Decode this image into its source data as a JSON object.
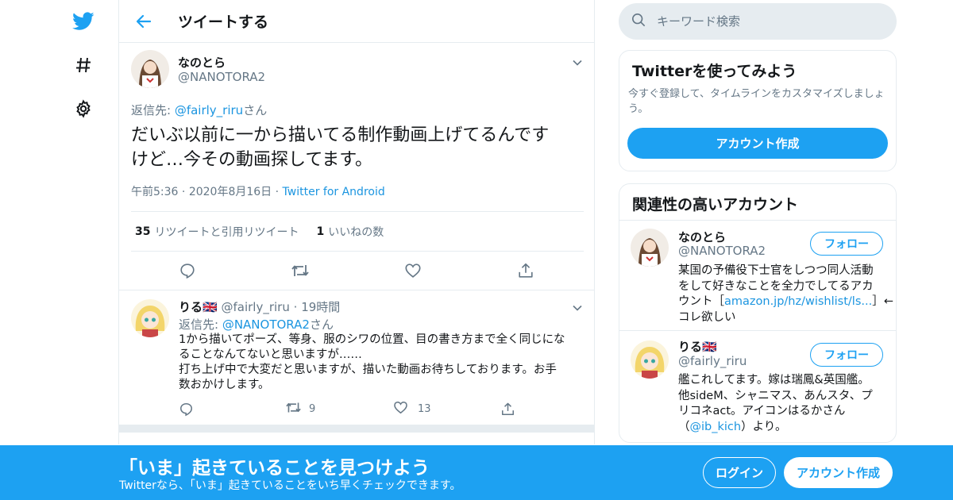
{
  "nav": {
    "icons": [
      "twitter-bird-icon",
      "hashtag-icon",
      "gear-icon"
    ]
  },
  "header": {
    "title": "ツイートする"
  },
  "main_tweet": {
    "name": "なのとら",
    "handle": "@NANOTORA2",
    "reply_prefix": "返信先: ",
    "reply_to": "@fairly_riru",
    "reply_suffix": "さん",
    "text_line1": "だいぶ以前に一から描いてる制作動画上げてるんです",
    "text_line2": "けど…今その動画探してます。",
    "time": "午前5:36",
    "date": "2020年8月16日",
    "client": "Twitter for Android",
    "retweet_count": "35",
    "retweet_label": "リツイートと引用リツイート",
    "like_count": "1",
    "like_label": "いいねの数"
  },
  "reply_tweet": {
    "name": "りる🇬🇧",
    "handle": "@fairly_riru",
    "time": "19時間",
    "reply_prefix": "返信先: ",
    "reply_to": "@NANOTORA2",
    "reply_suffix": "さん",
    "line1": "1から描いてポーズ、等身、服のシワの位置、目の書き方まで全く同じにな",
    "line2": "ることなんてないと思いますが……",
    "line3": "打ち上げ中で大変だと思いますが、描いた動画お待ちしております。お手",
    "line4": "数おかけします。",
    "retweets": "9",
    "likes": "13"
  },
  "search": {
    "placeholder": "キーワード検索"
  },
  "signup_card": {
    "title": "Twitterを使ってみよう",
    "desc_line1": "今すぐ登録して、タイムラインをカスタマイズしましょ",
    "desc_line2": "う。",
    "button": "アカウント作成"
  },
  "related": {
    "title": "関連性の高いアカウント",
    "follow_label": "フォロー",
    "accounts": [
      {
        "name": "なのとら",
        "handle": "@NANOTORA2",
        "bio_l1": "某国の予備役下士官をしつつ同人活動",
        "bio_l2": "をして好きなことを全力でしてるアカ",
        "bio_l3a": "ウント［",
        "bio_link": "amazon.jp/hz/wishlist/ls...",
        "bio_l3b": "］←",
        "bio_l4": "コレ欲しい"
      },
      {
        "name": "りる🇬🇧",
        "handle": "@fairly_riru",
        "bio_l1": "艦これしてます。嫁は瑞鳳&英国艦。",
        "bio_l2": "他sideM、シャニマス、あんスタ、プ",
        "bio_l3": "リコネact。アイコンはるかさん",
        "bio_l4a": "（",
        "bio_link": "@ib_kich",
        "bio_l4b": "）より。"
      }
    ]
  },
  "banner": {
    "title": "「いま」起きていることを見つけよう",
    "subtitle": "Twitterなら、「いま」起きていることをいち早くチェックできます。",
    "login": "ログイン",
    "signup": "アカウント作成"
  },
  "colors": {
    "accent": "#1da1f2",
    "link": "#1b95e0",
    "muted": "#657786",
    "border": "#e6ecf0"
  }
}
